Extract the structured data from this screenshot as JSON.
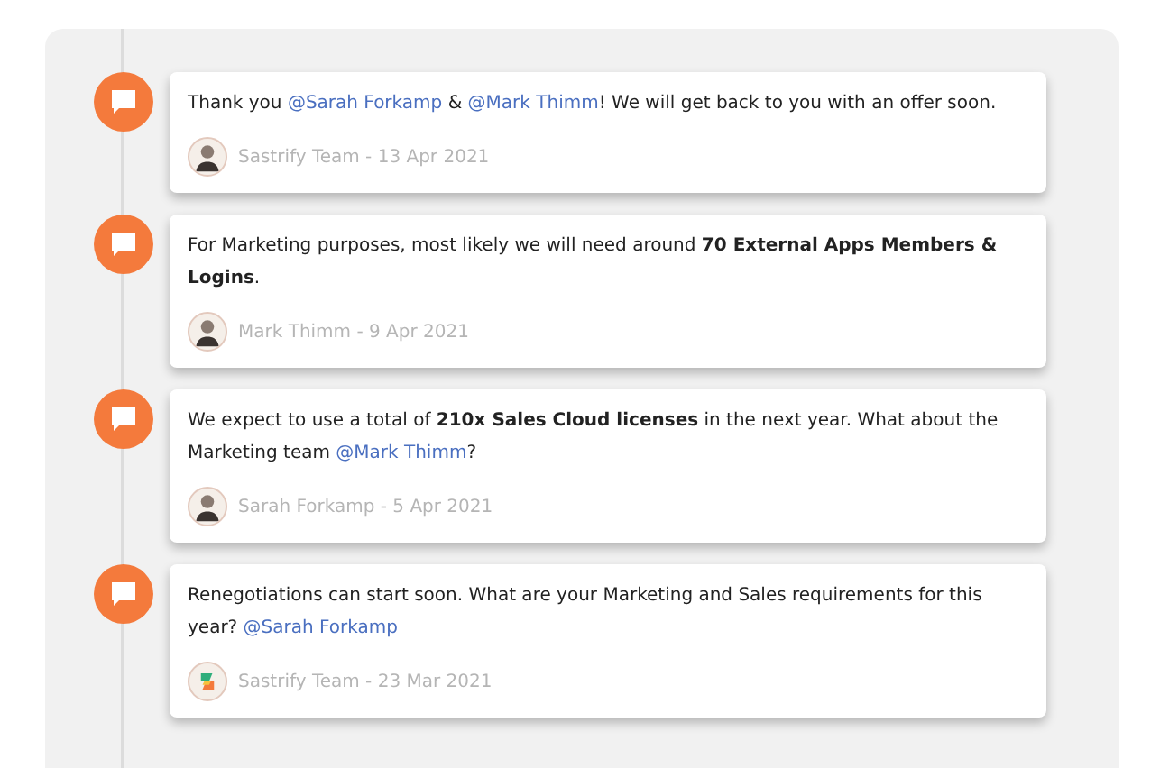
{
  "comments": [
    {
      "message": [
        {
          "kind": "plain",
          "text": "Thank you "
        },
        {
          "kind": "mention",
          "text": "@Sarah Forkamp"
        },
        {
          "kind": "plain",
          "text": " & "
        },
        {
          "kind": "mention",
          "text": "@Mark Thimm"
        },
        {
          "kind": "plain",
          "text": "! We will get back to you with an offer soon."
        }
      ],
      "avatar": {
        "kind": "person"
      },
      "meta": "Sastrify Team - 13 Apr 2021"
    },
    {
      "message": [
        {
          "kind": "plain",
          "text": "For Marketing purposes, most likely we will need around "
        },
        {
          "kind": "bold",
          "text": "70 External Apps Members & Logins"
        },
        {
          "kind": "plain",
          "text": "."
        }
      ],
      "avatar": {
        "kind": "person"
      },
      "meta": "Mark Thimm - 9 Apr 2021"
    },
    {
      "message": [
        {
          "kind": "plain",
          "text": "We expect to use a total of "
        },
        {
          "kind": "bold",
          "text": "210x Sales Cloud licenses"
        },
        {
          "kind": "plain",
          "text": " in the next year. What about the Marketing team "
        },
        {
          "kind": "mention",
          "text": "@Mark Thimm"
        },
        {
          "kind": "plain",
          "text": "?"
        }
      ],
      "avatar": {
        "kind": "person"
      },
      "meta": "Sarah Forkamp - 5 Apr 2021"
    },
    {
      "message": [
        {
          "kind": "plain",
          "text": "Renegotiations can start soon. What are your Marketing and Sales requirements for this year? "
        },
        {
          "kind": "mention",
          "text": "@Sarah Forkamp"
        }
      ],
      "avatar": {
        "kind": "logo"
      },
      "meta": "Sastrify Team - 23 Mar 2021"
    }
  ]
}
